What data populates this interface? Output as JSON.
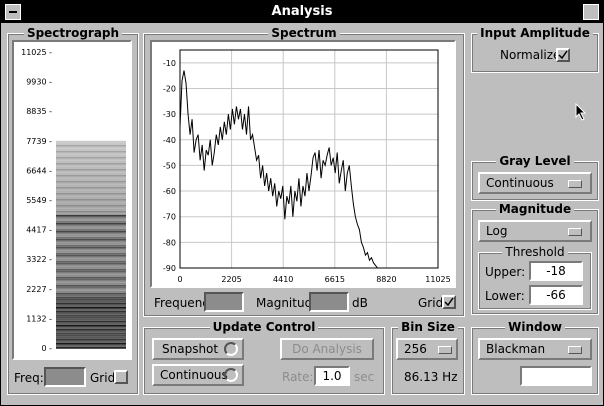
{
  "window": {
    "title": "Analysis"
  },
  "spectrograph": {
    "title": "Spectrograph",
    "ticks": [
      "11025 -",
      "9930 -",
      "8835 -",
      "7739 -",
      "6644 -",
      "5549 -",
      "4417 -",
      "3322 -",
      "2227 -",
      "1132 -",
      "0 -"
    ],
    "freq_label": "Freq:",
    "grid_label": "Grid"
  },
  "spectrum": {
    "title": "Spectrum",
    "frequency_label": "Frequency:",
    "magnitude_label": "Magnitude:",
    "db_unit": "dB",
    "grid_label": "Grid"
  },
  "chart_data": {
    "type": "line",
    "x_ticks": [
      "0",
      "2205",
      "4410",
      "6615",
      "8820",
      "11025"
    ],
    "y_ticks": [
      "-10",
      "-20",
      "-30",
      "-40",
      "-50",
      "-60",
      "-70",
      "-80",
      "-90"
    ],
    "xlim": [
      0,
      11025
    ],
    "ylim": [
      -90,
      -5
    ],
    "grid": true,
    "series": [
      {
        "x": [
          0,
          86,
          172,
          258,
          344,
          430,
          517,
          603,
          689,
          775,
          861,
          947,
          1034,
          1120,
          1206,
          1292,
          1378,
          1464,
          1550,
          1636,
          1722,
          1808,
          1894,
          1980,
          2067,
          2153,
          2239,
          2325,
          2411,
          2497,
          2583,
          2670,
          2756,
          2842,
          2928,
          3014,
          3100,
          3187,
          3273,
          3359,
          3445,
          3531,
          3617,
          3703,
          3790,
          3876,
          3962,
          4048,
          4134,
          4220,
          4306,
          4393,
          4479,
          4565,
          4651,
          4737,
          4823,
          4909,
          4996,
          5082,
          5168,
          5254,
          5340,
          5426,
          5512,
          5599,
          5685,
          5771,
          5857,
          5943,
          6029,
          6115,
          6202,
          6288,
          6374,
          6460,
          6546,
          6632,
          6718,
          6805,
          6891,
          6977,
          7063,
          7149,
          7235,
          7321,
          7408,
          7494,
          7580,
          7666,
          7752,
          7838,
          7924,
          8011,
          8097,
          8183,
          8269,
          8355,
          8441,
          8527,
          8613,
          8700,
          8786,
          8872,
          8958,
          9044,
          11025
        ],
        "y": [
          -35,
          -17,
          -13,
          -18,
          -30,
          -38,
          -32,
          -45,
          -40,
          -38,
          -48,
          -42,
          -52,
          -44,
          -46,
          -40,
          -50,
          -45,
          -38,
          -42,
          -35,
          -40,
          -33,
          -38,
          -30,
          -36,
          -28,
          -34,
          -27,
          -32,
          -28,
          -36,
          -30,
          -38,
          -27,
          -40,
          -38,
          -43,
          -48,
          -46,
          -55,
          -50,
          -58,
          -53,
          -60,
          -55,
          -62,
          -57,
          -66,
          -60,
          -63,
          -58,
          -71,
          -62,
          -65,
          -58,
          -70,
          -60,
          -64,
          -55,
          -66,
          -58,
          -62,
          -53,
          -60,
          -54,
          -47,
          -45,
          -52,
          -44,
          -55,
          -48,
          -50,
          -46,
          -43,
          -50,
          -47,
          -53,
          -45,
          -57,
          -52,
          -48,
          -60,
          -53,
          -50,
          -58,
          -65,
          -70,
          -73,
          -75,
          -80,
          -82,
          -85,
          -84,
          -87,
          -86,
          -88,
          -89,
          -90,
          -90,
          -90,
          -90,
          -90,
          -90,
          -90,
          -90,
          -90
        ]
      }
    ]
  },
  "input_amplitude": {
    "title": "Input Amplitude",
    "normalize_label": "Normalize"
  },
  "gray_level": {
    "title": "Gray Level",
    "selected": "Continuous"
  },
  "magnitude": {
    "title": "Magnitude",
    "selected": "Log",
    "threshold": {
      "title": "Threshold",
      "upper_label": "Upper:",
      "upper_value": "-18",
      "lower_label": "Lower:",
      "lower_value": "-66"
    }
  },
  "update_control": {
    "title": "Update Control",
    "snapshot_label": "Snapshot",
    "continuous_label": "Continuous",
    "do_analysis_label": "Do Analysis",
    "rate_label": "Rate:",
    "rate_value": "1.0",
    "rate_unit": "sec"
  },
  "bin_size": {
    "title": "Bin Size",
    "selected": "256",
    "resolution": "86.13 Hz"
  },
  "window_panel": {
    "title": "Window",
    "selected": "Blackman",
    "text_value": ""
  },
  "colors": {
    "background": "#bebebe",
    "titlebar": "#000000"
  }
}
